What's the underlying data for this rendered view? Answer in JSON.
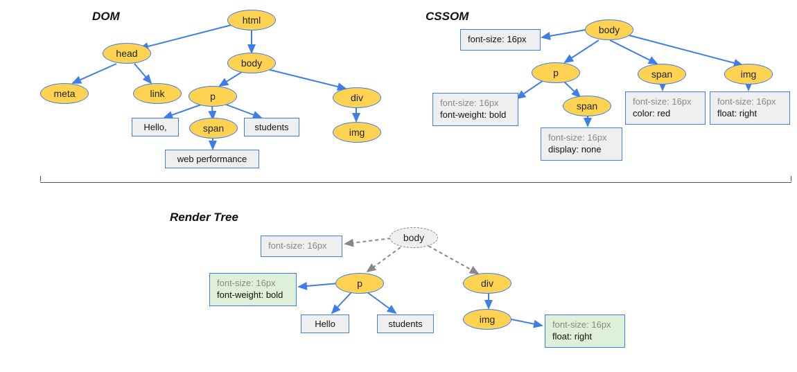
{
  "headings": {
    "dom": "DOM",
    "cssom": "CSSOM",
    "render": "Render Tree"
  },
  "dom": {
    "html": "html",
    "head": "head",
    "body": "body",
    "meta": "meta",
    "link": "link",
    "p": "p",
    "div": "div",
    "img": "img",
    "span": "span",
    "hello": "Hello,",
    "students": "students",
    "webperf": "web performance"
  },
  "cssom": {
    "body": "body",
    "p": "p",
    "span_child": "span",
    "span": "span",
    "img": "img",
    "body_style": {
      "a": "font-size: 16px"
    },
    "p_style": {
      "a": "font-size: 16px",
      "b": "font-weight: bold"
    },
    "spanchild_style": {
      "a": "font-size: 16px",
      "b": "display: none"
    },
    "span_style": {
      "a": "font-size: 16px",
      "b": "color: red"
    },
    "img_style": {
      "a": "font-size: 16px",
      "b": "float: right"
    }
  },
  "render": {
    "body": "body",
    "p": "p",
    "div": "div",
    "img": "img",
    "hello": "Hello",
    "students": "students",
    "body_style": {
      "a": "font-size: 16px"
    },
    "p_style": {
      "a": "font-size: 16px",
      "b": "font-weight: bold"
    },
    "img_style": {
      "a": "font-size: 16px",
      "b": "float: right"
    }
  }
}
